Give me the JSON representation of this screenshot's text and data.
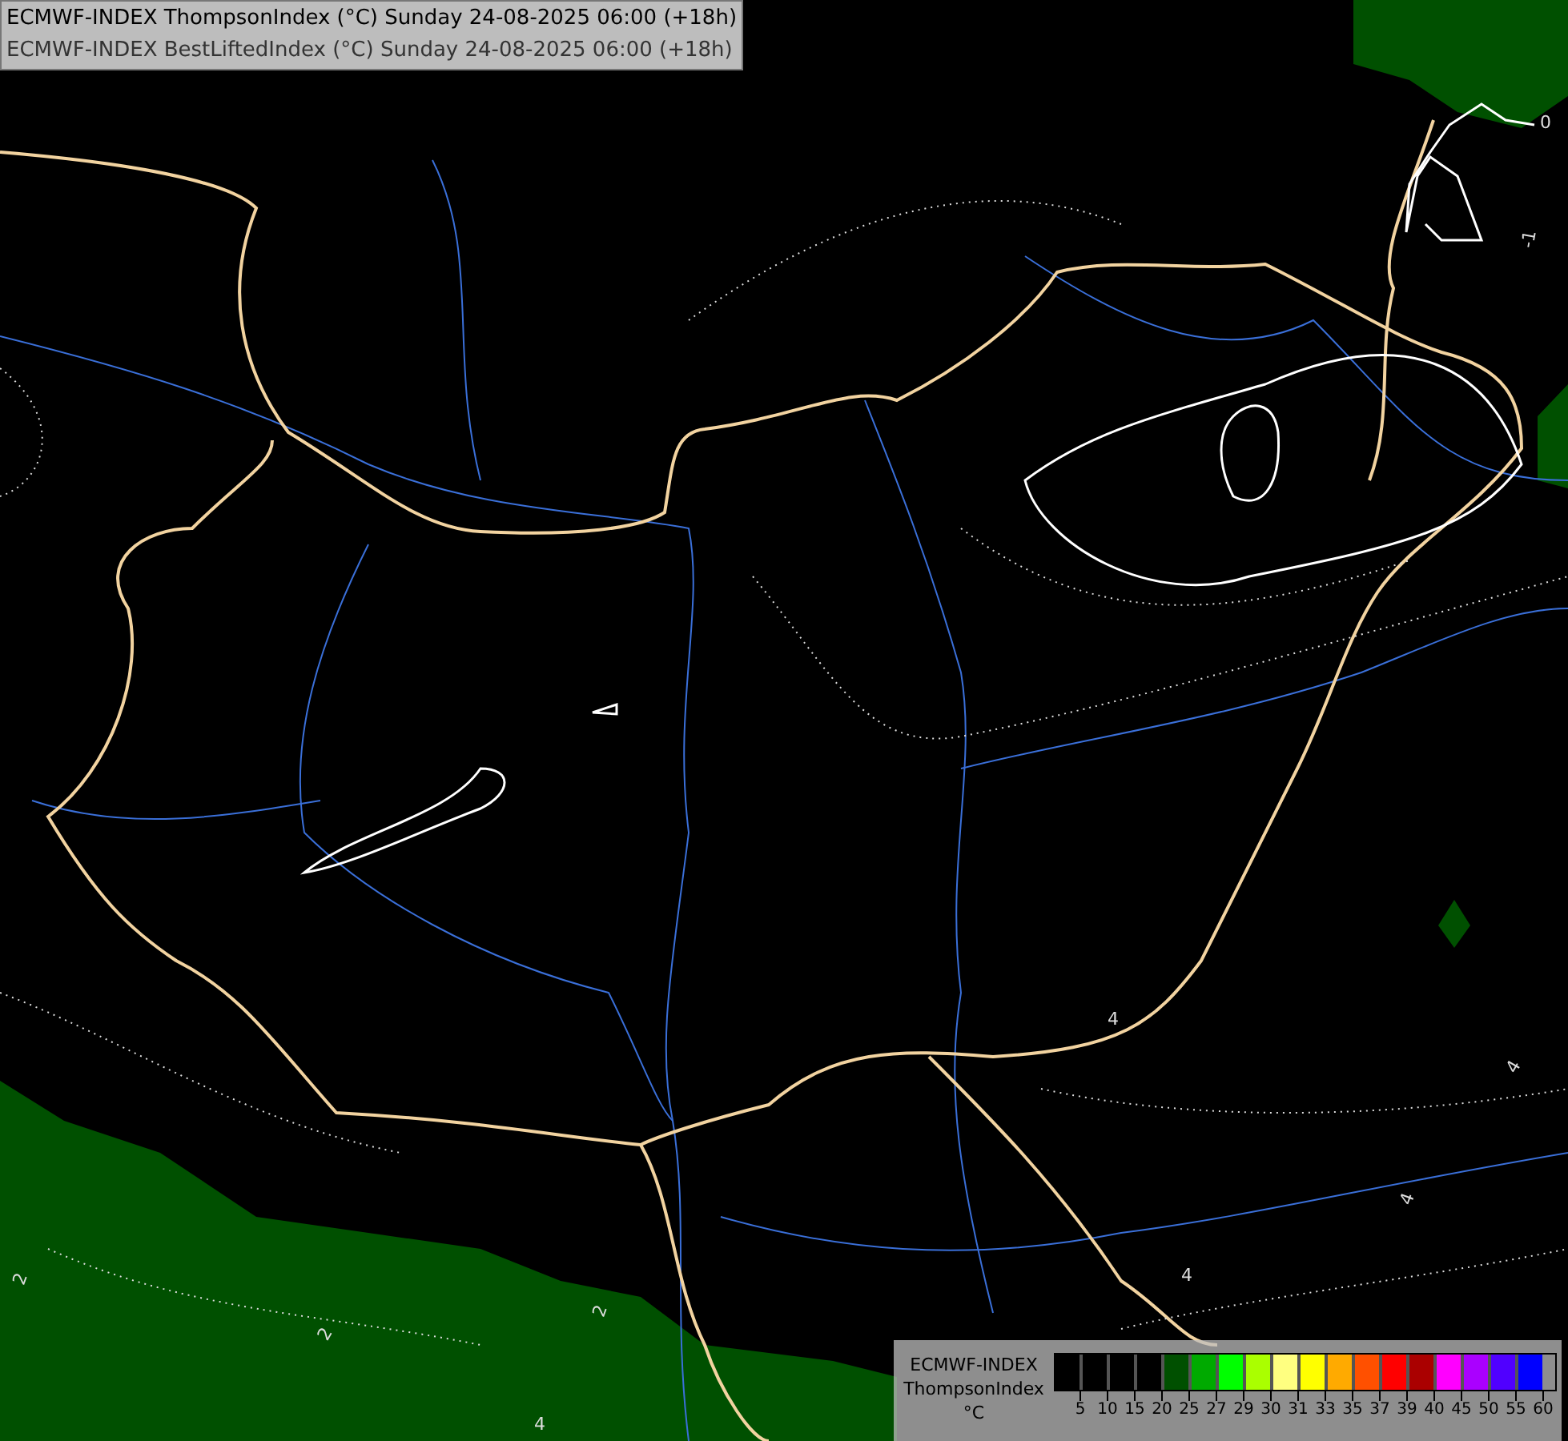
{
  "header": {
    "lines": [
      "ECMWF-INDEX ThompsonIndex (°C) Sunday 24-08-2025 06:00 (+18h)",
      "ECMWF-INDEX BestLiftedIndex (°C) Sunday 24-08-2025 06:00 (+18h)"
    ]
  },
  "map": {
    "contour_labels": [
      "0",
      "-1",
      "2",
      "2",
      "2",
      "4",
      "4",
      "4",
      "4",
      "4"
    ]
  },
  "legend": {
    "title_lines": [
      "ECMWF-INDEX",
      "ThompsonIndex",
      "°C"
    ],
    "swatches": [
      {
        "color": "#000000"
      },
      {
        "color": "#000000"
      },
      {
        "color": "#000000"
      },
      {
        "color": "#000000"
      },
      {
        "color": "#005000"
      },
      {
        "color": "#00aa00"
      },
      {
        "color": "#00ff00"
      },
      {
        "color": "#aaff00"
      },
      {
        "color": "#ffff80"
      },
      {
        "color": "#ffff00"
      },
      {
        "color": "#ffaa00"
      },
      {
        "color": "#ff5000"
      },
      {
        "color": "#ff0000"
      },
      {
        "color": "#aa0000"
      },
      {
        "color": "#ff00ff"
      },
      {
        "color": "#aa00ff"
      },
      {
        "color": "#5000ff"
      },
      {
        "color": "#0000ff"
      }
    ],
    "ticks": [
      "5",
      "10",
      "15",
      "20",
      "25",
      "27",
      "29",
      "30",
      "31",
      "33",
      "35",
      "37",
      "39",
      "40",
      "45",
      "50",
      "55",
      "60"
    ]
  }
}
